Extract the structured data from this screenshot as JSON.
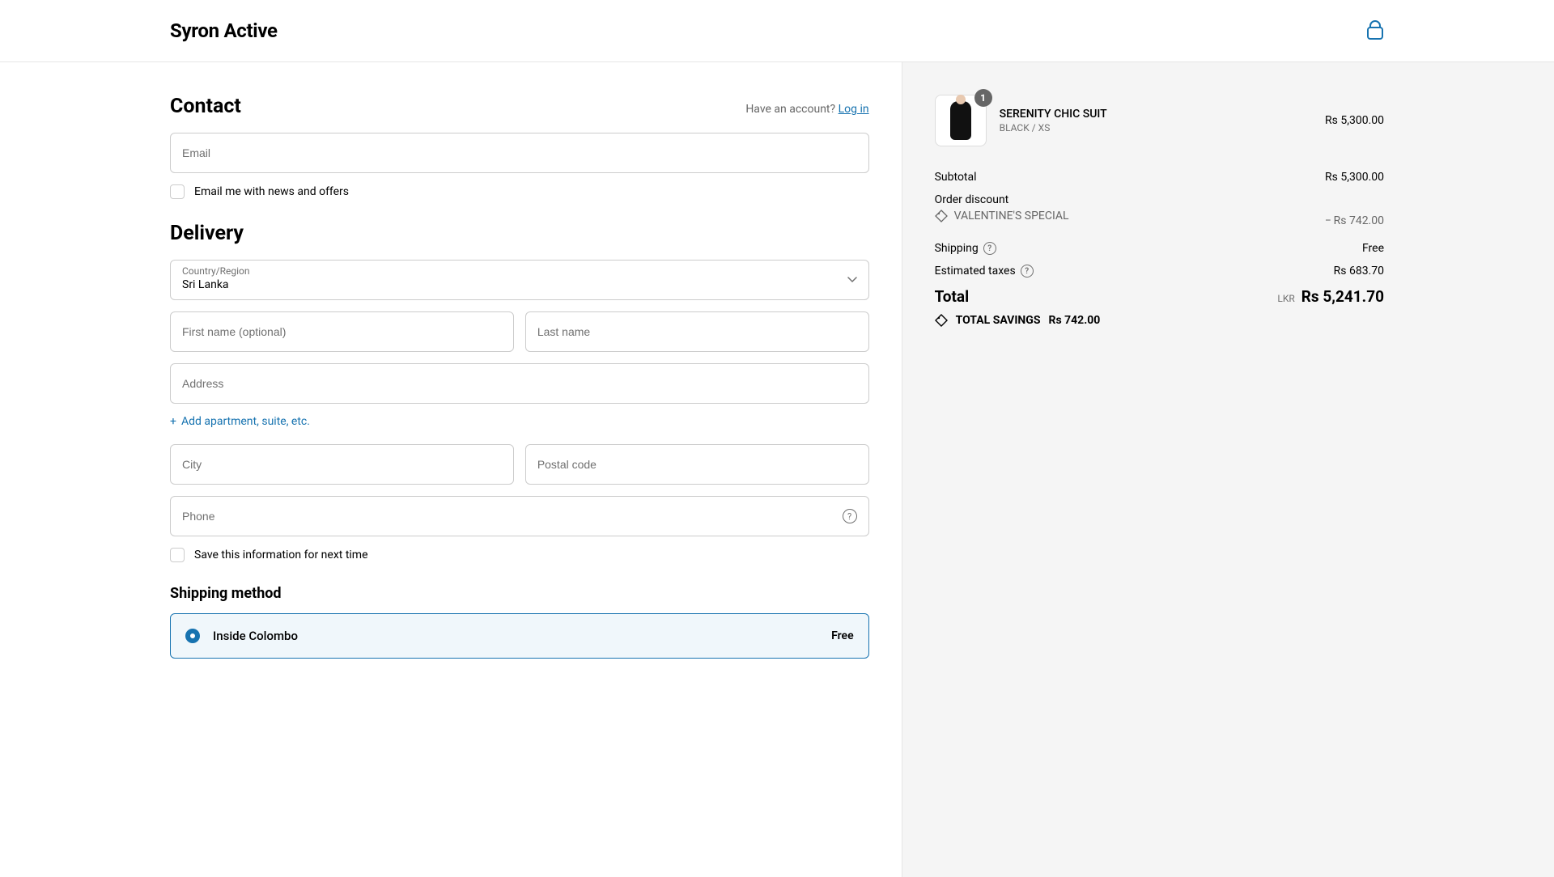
{
  "brand": "Syron Active",
  "contact": {
    "title": "Contact",
    "prompt": "Have an account?",
    "login": "Log in",
    "email_placeholder": "Email",
    "news_label": "Email me with news and offers"
  },
  "delivery": {
    "title": "Delivery",
    "country_label": "Country/Region",
    "country_value": "Sri Lanka",
    "first_name_placeholder": "First name (optional)",
    "last_name_placeholder": "Last name",
    "address_placeholder": "Address",
    "add_apartment": "Add apartment, suite, etc.",
    "city_placeholder": "City",
    "postal_placeholder": "Postal code",
    "phone_placeholder": "Phone",
    "save_info_label": "Save this information for next time"
  },
  "shipping": {
    "title": "Shipping method",
    "option_label": "Inside Colombo",
    "option_price": "Free"
  },
  "cart": {
    "item": {
      "qty": "1",
      "name": "SERENITY CHIC SUIT",
      "variant": "BLACK / XS",
      "price": "Rs 5,300.00"
    },
    "subtotal_label": "Subtotal",
    "subtotal_value": "Rs 5,300.00",
    "discount_label": "Order discount",
    "discount_code": "VALENTINE'S SPECIAL",
    "discount_value": "− Rs 742.00",
    "shipping_label": "Shipping",
    "shipping_value": "Free",
    "tax_label": "Estimated taxes",
    "tax_value": "Rs 683.70",
    "total_label": "Total",
    "total_currency": "LKR",
    "total_value": "Rs 5,241.70",
    "savings_label": "TOTAL SAVINGS",
    "savings_value": "Rs 742.00"
  }
}
